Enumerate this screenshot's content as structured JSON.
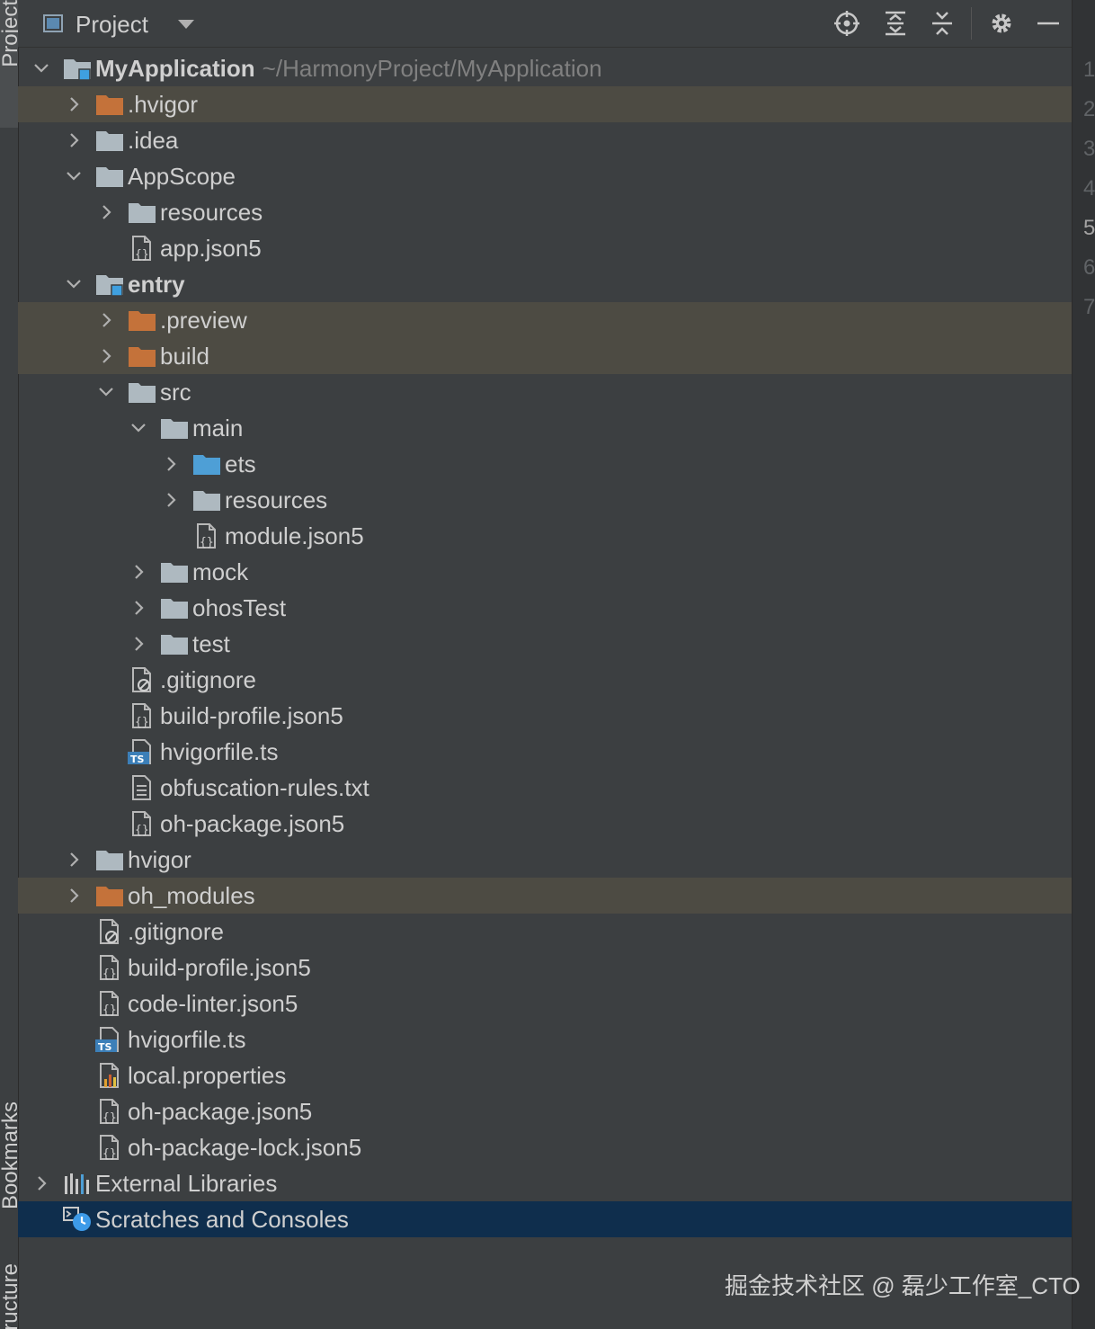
{
  "left_strip": {
    "tabs": [
      "Project",
      "Bookmarks",
      "Structure"
    ]
  },
  "header": {
    "title": "Project",
    "icons": [
      "locate-icon",
      "expand-all-icon",
      "collapse-all-icon",
      "gear-icon",
      "minimize-icon"
    ]
  },
  "tree": [
    {
      "label": "MyApplication",
      "path": "~/HarmonyProject/MyApplication",
      "depth": 0,
      "chevron": "down",
      "icon": "module-folder",
      "bold": true
    },
    {
      "label": ".hvigor",
      "depth": 1,
      "chevron": "right",
      "icon": "folder-orange",
      "vcs": true
    },
    {
      "label": ".idea",
      "depth": 1,
      "chevron": "right",
      "icon": "folder"
    },
    {
      "label": "AppScope",
      "depth": 1,
      "chevron": "down",
      "icon": "folder"
    },
    {
      "label": "resources",
      "depth": 2,
      "chevron": "right",
      "icon": "folder"
    },
    {
      "label": "app.json5",
      "depth": 2,
      "chevron": "none",
      "icon": "json-file"
    },
    {
      "label": "entry",
      "depth": 1,
      "chevron": "down",
      "icon": "module-folder",
      "bold": true
    },
    {
      "label": ".preview",
      "depth": 2,
      "chevron": "right",
      "icon": "folder-orange",
      "vcs": true
    },
    {
      "label": "build",
      "depth": 2,
      "chevron": "right",
      "icon": "folder-orange",
      "vcs": true
    },
    {
      "label": "src",
      "depth": 2,
      "chevron": "down",
      "icon": "folder"
    },
    {
      "label": "main",
      "depth": 3,
      "chevron": "down",
      "icon": "folder"
    },
    {
      "label": "ets",
      "depth": 4,
      "chevron": "right",
      "icon": "folder-blue"
    },
    {
      "label": "resources",
      "depth": 4,
      "chevron": "right",
      "icon": "folder"
    },
    {
      "label": "module.json5",
      "depth": 4,
      "chevron": "none",
      "icon": "json-file"
    },
    {
      "label": "mock",
      "depth": 3,
      "chevron": "right",
      "icon": "folder"
    },
    {
      "label": "ohosTest",
      "depth": 3,
      "chevron": "right",
      "icon": "folder"
    },
    {
      "label": "test",
      "depth": 3,
      "chevron": "right",
      "icon": "folder"
    },
    {
      "label": ".gitignore",
      "depth": 2,
      "chevron": "none",
      "icon": "ignore-file"
    },
    {
      "label": "build-profile.json5",
      "depth": 2,
      "chevron": "none",
      "icon": "json-file"
    },
    {
      "label": "hvigorfile.ts",
      "depth": 2,
      "chevron": "none",
      "icon": "ts-file"
    },
    {
      "label": "obfuscation-rules.txt",
      "depth": 2,
      "chevron": "none",
      "icon": "text-file"
    },
    {
      "label": "oh-package.json5",
      "depth": 2,
      "chevron": "none",
      "icon": "json-file"
    },
    {
      "label": "hvigor",
      "depth": 1,
      "chevron": "right",
      "icon": "folder"
    },
    {
      "label": "oh_modules",
      "depth": 1,
      "chevron": "right",
      "icon": "folder-orange",
      "vcs": true
    },
    {
      "label": ".gitignore",
      "depth": 1,
      "chevron": "none",
      "icon": "ignore-file"
    },
    {
      "label": "build-profile.json5",
      "depth": 1,
      "chevron": "none",
      "icon": "json-file"
    },
    {
      "label": "code-linter.json5",
      "depth": 1,
      "chevron": "none",
      "icon": "json-file"
    },
    {
      "label": "hvigorfile.ts",
      "depth": 1,
      "chevron": "none",
      "icon": "ts-file"
    },
    {
      "label": "local.properties",
      "depth": 1,
      "chevron": "none",
      "icon": "properties-file"
    },
    {
      "label": "oh-package.json5",
      "depth": 1,
      "chevron": "none",
      "icon": "json-file"
    },
    {
      "label": "oh-package-lock.json5",
      "depth": 1,
      "chevron": "none",
      "icon": "json-file"
    },
    {
      "label": "External Libraries",
      "depth": 0,
      "chevron": "right",
      "icon": "libraries"
    },
    {
      "label": "Scratches and Consoles",
      "depth": 0,
      "chevron": "none",
      "icon": "scratches",
      "selected": true
    }
  ],
  "gutter": {
    "line_numbers": [
      "1",
      "2",
      "3",
      "4",
      "5",
      "6",
      "7"
    ],
    "current_line": "5"
  },
  "watermark": "掘金技术社区 @ 磊少工作室_CTO",
  "colors": {
    "panel_bg": "#3c3f41",
    "vcs_ignored_bg": "#4d4b43",
    "selected_bg": "#0f2e4d",
    "folder": "#aeb9c0",
    "folder_orange": "#c4723a",
    "folder_blue": "#4e9fd6"
  }
}
